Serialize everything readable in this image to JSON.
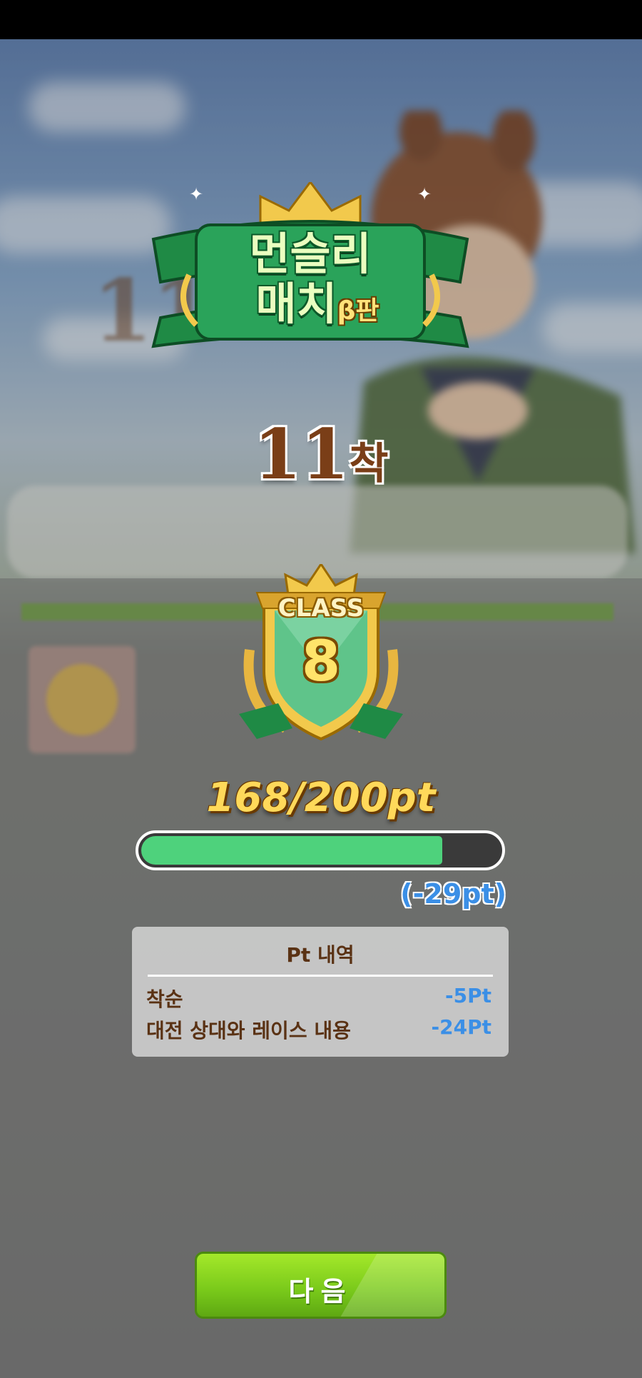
{
  "logo": {
    "line1": "먼슬리",
    "line2": "매치",
    "beta": "β판"
  },
  "result": {
    "rank_number": "11",
    "rank_suffix": "착"
  },
  "class_badge": {
    "label": "CLASS",
    "level": "8"
  },
  "points": {
    "text": "168/200pt",
    "current": 168,
    "max": 200,
    "delta": "(-29pt)"
  },
  "breakdown": {
    "title": "Pt 내역",
    "rows": [
      {
        "label": "착순",
        "value": "-5Pt"
      },
      {
        "label": "대전 상대와 레이스 내용",
        "value": "-24Pt"
      }
    ]
  },
  "next_button": {
    "label": "다음"
  },
  "colors": {
    "progress_fill": "#4ed27c",
    "delta_blue": "#3b8fe6",
    "button_green": "#78c81a",
    "rank_brown": "#7a3e17"
  }
}
